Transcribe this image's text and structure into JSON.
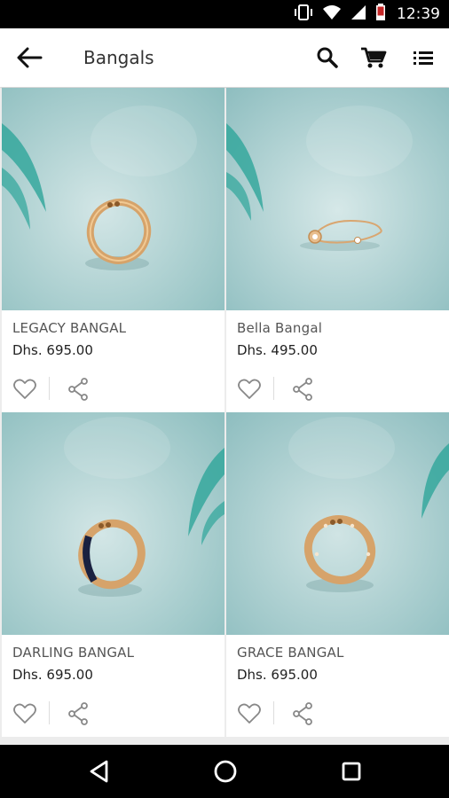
{
  "status_bar": {
    "time": "12:39",
    "icons": [
      "vibrate-icon",
      "wifi-icon",
      "signal-icon",
      "battery-icon"
    ]
  },
  "app_bar": {
    "title": "Bangals",
    "icons": [
      "back-arrow-icon",
      "search-icon",
      "cart-icon",
      "list-icon"
    ]
  },
  "products": [
    {
      "name": "LEGACY BANGAL",
      "price": "Dhs. 695.00"
    },
    {
      "name": "Bella Bangal",
      "price": "Dhs. 495.00"
    },
    {
      "name": "DARLING BANGAL",
      "price": "Dhs. 695.00"
    },
    {
      "name": "GRACE BANGAL",
      "price": "Dhs. 695.00"
    }
  ],
  "nav_bar": {
    "icons": [
      "back-triangle-icon",
      "home-circle-icon",
      "recents-square-icon"
    ]
  },
  "colors": {
    "image_bg": "#b9d6d6",
    "gold": "#d6a36a",
    "leaf": "#2ea59a",
    "accent_dark": "#111111"
  }
}
